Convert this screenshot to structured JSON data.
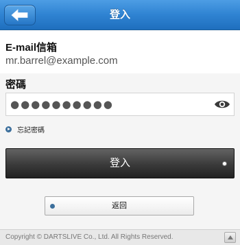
{
  "header": {
    "title": "登入",
    "back_icon": "arrow-left-icon",
    "color": "#2f83d2"
  },
  "email": {
    "label": "E-mail信箱",
    "value": "mr.barrel@example.com"
  },
  "password": {
    "label": "密碼",
    "masked_value": "●●●●●●●●●●",
    "visibility_icon": "eye-icon"
  },
  "forgot_password": {
    "label": "忘記密碼"
  },
  "login_button": {
    "label": "登入"
  },
  "back_button": {
    "label": "返回"
  },
  "footer": {
    "copyright": "Copyright © DARTSLIVE Co., Ltd. All Rights Reserved.",
    "top_icon": "arrow-up-icon"
  }
}
